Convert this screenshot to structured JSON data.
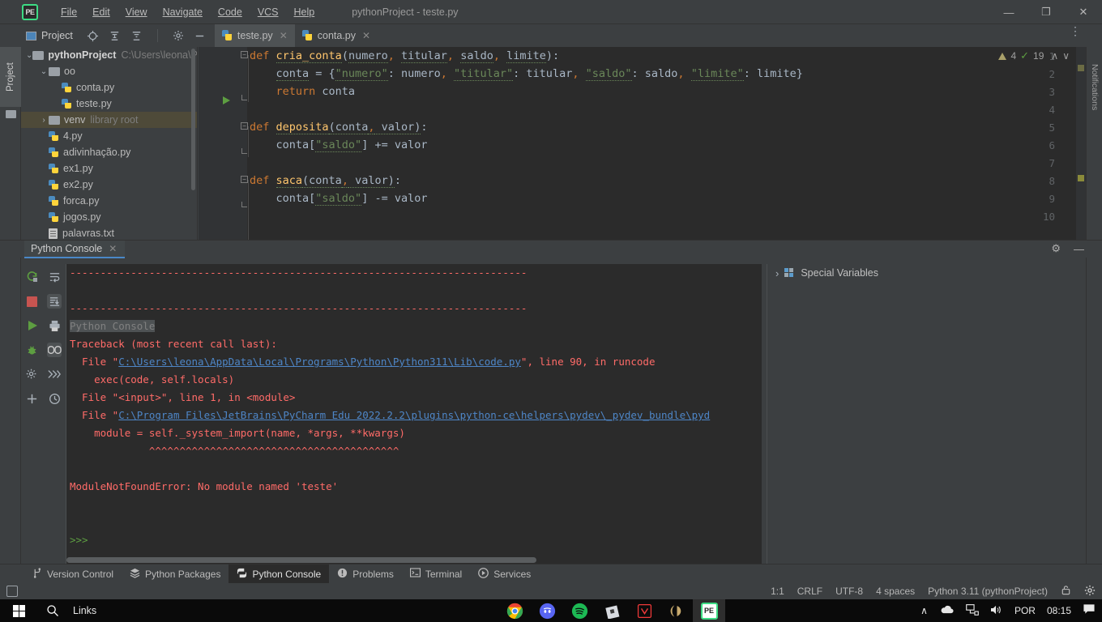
{
  "titlebar": {
    "logo": "PE",
    "menus": [
      "File",
      "Edit",
      "View",
      "Navigate",
      "Code",
      "VCS",
      "Help"
    ],
    "window_title": "pythonProject - teste.py",
    "minimize": "—",
    "maximize": "❐",
    "close": "✕"
  },
  "toolbar": {
    "project_label": "Project",
    "icons": [
      "locate-icon",
      "expand-all-icon",
      "collapse-all-icon",
      "gear-icon",
      "hide-icon"
    ],
    "kebab": "⋮"
  },
  "tabs": [
    {
      "label": "teste.py",
      "active": true,
      "close": "✕"
    },
    {
      "label": "conta.py",
      "active": false,
      "close": "✕"
    }
  ],
  "left_strip": {
    "label": "Project"
  },
  "right_strip": {
    "label": "Notifications"
  },
  "tree": {
    "items": [
      {
        "chev": "⌄",
        "icon": "folder",
        "label": "pythonProject",
        "bold": true,
        "note": "C:\\Users\\leona\\Py",
        "indent": 0,
        "selected": false
      },
      {
        "chev": "⌄",
        "icon": "folder",
        "label": "oo",
        "bold": false,
        "note": "",
        "indent": 1,
        "selected": false
      },
      {
        "chev": "",
        "icon": "py",
        "label": "conta.py",
        "bold": false,
        "note": "",
        "indent": 2,
        "selected": false
      },
      {
        "chev": "",
        "icon": "py",
        "label": "teste.py",
        "bold": false,
        "note": "",
        "indent": 2,
        "selected": false
      },
      {
        "chev": "›",
        "icon": "folder",
        "label": "venv",
        "bold": false,
        "note": "library root",
        "indent": 1,
        "selected": true
      },
      {
        "chev": "",
        "icon": "py",
        "label": "4.py",
        "bold": false,
        "note": "",
        "indent": 1,
        "selected": false
      },
      {
        "chev": "",
        "icon": "py",
        "label": "adivinhação.py",
        "bold": false,
        "note": "",
        "indent": 1,
        "selected": false
      },
      {
        "chev": "",
        "icon": "py",
        "label": "ex1.py",
        "bold": false,
        "note": "",
        "indent": 1,
        "selected": false
      },
      {
        "chev": "",
        "icon": "py",
        "label": "ex2.py",
        "bold": false,
        "note": "",
        "indent": 1,
        "selected": false
      },
      {
        "chev": "",
        "icon": "py",
        "label": "forca.py",
        "bold": false,
        "note": "",
        "indent": 1,
        "selected": false
      },
      {
        "chev": "",
        "icon": "py",
        "label": "jogos.py",
        "bold": false,
        "note": "",
        "indent": 1,
        "selected": false
      },
      {
        "chev": "",
        "icon": "txt",
        "label": "palavras.txt",
        "bold": false,
        "note": "",
        "indent": 1,
        "selected": false
      }
    ]
  },
  "editor": {
    "filename": "teste.py",
    "line_numbers": [
      "1",
      "2",
      "3",
      "4",
      "5",
      "6",
      "7",
      "8",
      "9",
      "10"
    ],
    "lines": [
      "def cria_conta(numero, titular, saldo, limite):",
      "    conta = {\"numero\": numero, \"titular\": titular, \"saldo\": saldo, \"limite\": limite}",
      "    return conta",
      "",
      "def deposita(conta, valor):",
      "    conta[\"saldo\"] += valor",
      "",
      "def saca(conta, valor):",
      "    conta[\"saldo\"] -= valor",
      ""
    ],
    "warning_count": "4",
    "check_count": "19",
    "chevron_up": "∧",
    "chevron_down": "∨"
  },
  "console_panel": {
    "tab_label": "Python Console",
    "tab_close": "✕",
    "gear": "⚙",
    "minimize": "—",
    "left_tool_icons": [
      "rerun-icon",
      "soft-wrap-icon",
      "stop-icon",
      "scroll-to-end-icon",
      "execute-icon",
      "print-icon",
      "debug-icon",
      "show-variables-icon",
      "settings-icon",
      "fast-forward-icon",
      "add-icon",
      "history-icon"
    ],
    "output_lines": [
      {
        "text": "---------------------------------------------------------------------------",
        "style": "red"
      },
      {
        "text": "",
        "style": "plain"
      },
      {
        "text": "---------------------------------------------------------------------------",
        "style": "red"
      },
      {
        "text": "Python Console",
        "style": "grey-highlight"
      },
      {
        "text": "Traceback (most recent call last):",
        "style": "red"
      },
      {
        "text": "  File \"C:\\Users\\leona\\AppData\\Local\\Programs\\Python\\Python311\\Lib\\code.py\", line 90, in runcode",
        "style": "red-link",
        "link": "C:\\Users\\leona\\AppData\\Local\\Programs\\Python\\Python311\\Lib\\code.py"
      },
      {
        "text": "    exec(code, self.locals)",
        "style": "red"
      },
      {
        "text": "  File \"<input>\", line 1, in <module>",
        "style": "red"
      },
      {
        "text": "  File \"C:\\Program Files\\JetBrains\\PyCharm Edu 2022.2.2\\plugins\\python-ce\\helpers\\pydev\\_pydev_bundle\\pyd",
        "style": "red-link2",
        "link": "C:\\Program Files\\JetBrains\\PyCharm Edu 2022.2.2\\plugins\\python-ce\\helpers\\pydev\\_pydev_bundle\\pyd"
      },
      {
        "text": "    module = self._system_import(name, *args, **kwargs)",
        "style": "red"
      },
      {
        "text": "             ^^^^^^^^^^^^^^^^^^^^^^^^^^^^^^^^^^^^^^^^^",
        "style": "red"
      },
      {
        "text": "",
        "style": "plain"
      },
      {
        "text": "ModuleNotFoundError: No module named 'teste'",
        "style": "red"
      },
      {
        "text": "",
        "style": "plain"
      },
      {
        "text": "",
        "style": "plain"
      },
      {
        "text": ">>>",
        "style": "green"
      }
    ],
    "variables": {
      "chevron": "›",
      "label": "Special Variables"
    }
  },
  "bottom_bar": {
    "buttons": [
      {
        "label": "Version Control",
        "icon": "branch-icon",
        "active": false
      },
      {
        "label": "Python Packages",
        "icon": "packages-icon",
        "active": false
      },
      {
        "label": "Python Console",
        "icon": "python-icon",
        "active": true
      },
      {
        "label": "Problems",
        "icon": "problems-icon",
        "active": false
      },
      {
        "label": "Terminal",
        "icon": "terminal-icon",
        "active": false
      },
      {
        "label": "Services",
        "icon": "services-icon",
        "active": false
      }
    ]
  },
  "status_bar": {
    "caret": "1:1",
    "line_sep": "CRLF",
    "encoding": "UTF-8",
    "indent": "4 spaces",
    "interpreter": "Python 3.11 (pythonProject)",
    "lock_icon": "lock-icon",
    "gear_icon": "gear-icon"
  },
  "taskbar": {
    "start": "windows-start-icon",
    "search": "search-icon",
    "links_label": "Links",
    "apps": [
      {
        "name": "chrome-icon",
        "active": false
      },
      {
        "name": "discord-icon",
        "active": false
      },
      {
        "name": "spotify-icon",
        "active": false
      },
      {
        "name": "roblox-icon",
        "active": false
      },
      {
        "name": "vivaldi-icon",
        "active": false
      },
      {
        "name": "league-of-legends-icon",
        "active": false
      },
      {
        "name": "pycharm-edu-icon",
        "active": true
      }
    ],
    "tray": {
      "chevron": "∧",
      "onedrive": "onedrive-icon",
      "network": "network-icon",
      "volume": "volume-icon",
      "language": "POR",
      "time": "08:15",
      "notifications": "notification-icon"
    }
  },
  "colors": {
    "bg_panel": "#3c3f41",
    "bg_editor": "#2b2b2b",
    "accent_blue": "#4a88c7",
    "error_red": "#ff6b68",
    "keyword_orange": "#cc7832",
    "string_green": "#6a8759",
    "function_yellow": "#ffc66d",
    "plain_text": "#a9b7c6"
  }
}
